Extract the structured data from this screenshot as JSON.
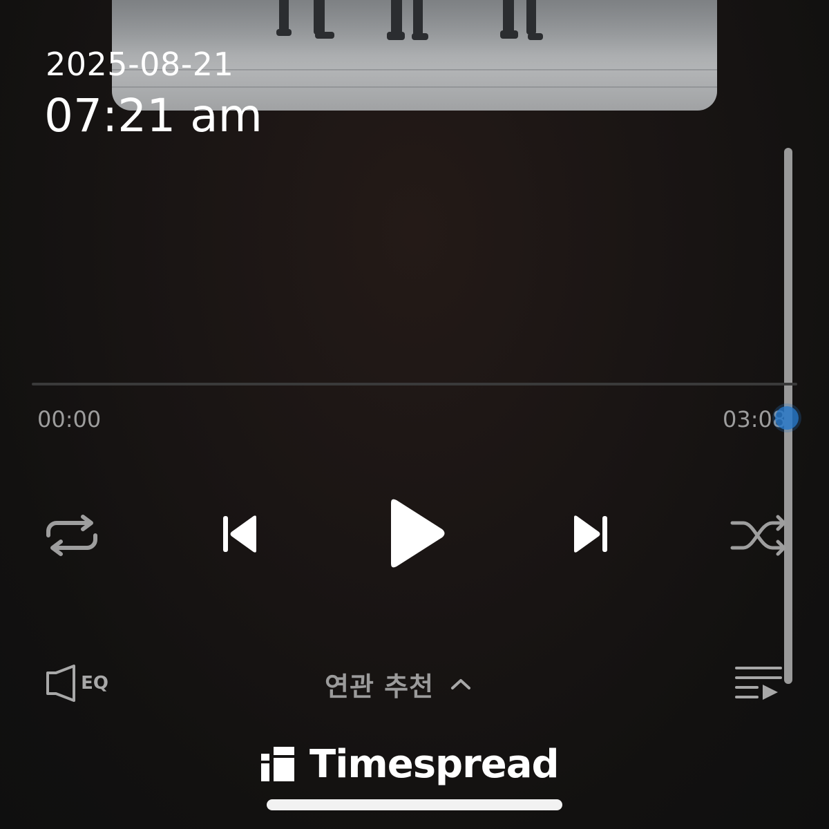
{
  "overlay": {
    "date": "2025-08-21",
    "time": "07:21 am"
  },
  "player": {
    "elapsed": "00:00",
    "duration": "03:08",
    "progress_fraction": 0.0,
    "controls": {
      "repeat_icon": "repeat-icon",
      "prev_icon": "skip-previous-icon",
      "play_icon": "play-icon",
      "next_icon": "skip-next-icon",
      "shuffle_icon": "shuffle-icon"
    },
    "bottom_bar": {
      "eq_label": "EQ",
      "related_label": "연관 추천",
      "queue_icon": "playlist-icon"
    }
  },
  "branding": {
    "name": "Timespread"
  },
  "colors": {
    "background": "#141110",
    "text_primary": "#ffffff",
    "text_secondary": "#9d9d9d",
    "accent_handle": "#2878c8"
  }
}
